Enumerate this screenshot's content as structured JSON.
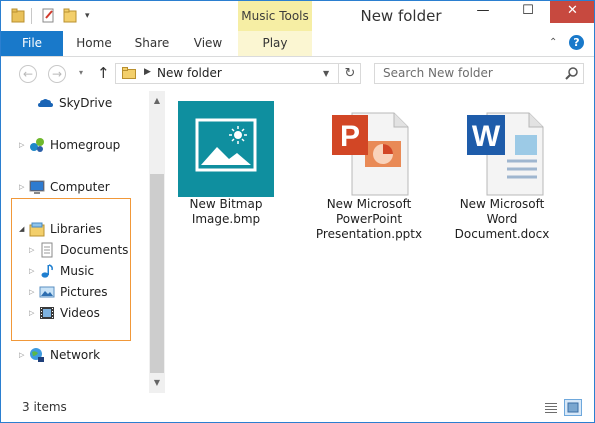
{
  "window": {
    "title": "New folder",
    "context_tab_group": "Music Tools",
    "close_glyph": "✕",
    "minimize_glyph": "—",
    "maximize_glyph": "☐"
  },
  "ribbon": {
    "tabs": [
      {
        "label": "File"
      },
      {
        "label": "Home"
      },
      {
        "label": "Share"
      },
      {
        "label": "View"
      },
      {
        "label": "Play"
      }
    ],
    "collapse_glyph": "⌃",
    "help_glyph": "?"
  },
  "navigation": {
    "back_glyph": "←",
    "forward_glyph": "→",
    "recent_glyph": "▾",
    "up_glyph": "↑",
    "address": {
      "path": "New folder",
      "separator_glyph": "▶",
      "dropdown_glyph": "▼",
      "refresh_glyph": "↻"
    },
    "search": {
      "placeholder": "Search New folder"
    }
  },
  "nav_pane": {
    "items": [
      {
        "label": "SkyDrive",
        "icon": "skydrive-icon"
      },
      {
        "label": "Homegroup",
        "icon": "homegroup-icon"
      },
      {
        "label": "Computer",
        "icon": "computer-icon"
      },
      {
        "label": "Libraries",
        "icon": "libraries-icon"
      },
      {
        "label": "Documents",
        "icon": "documents-icon"
      },
      {
        "label": "Music",
        "icon": "music-icon"
      },
      {
        "label": "Pictures",
        "icon": "pictures-icon"
      },
      {
        "label": "Videos",
        "icon": "videos-icon"
      },
      {
        "label": "Network",
        "icon": "network-icon"
      }
    ],
    "collapsed_glyph": "▷",
    "expanded_glyph": "◢",
    "highlight_color": "#f19839"
  },
  "scrollbar": {
    "up_glyph": "▲",
    "down_glyph": "▼"
  },
  "files": [
    {
      "name": "New Bitmap\nImage.bmp",
      "icon": "bitmap-image-icon"
    },
    {
      "name": "New Microsoft\nPowerPoint\nPresentation.pptx",
      "icon": "powerpoint-icon"
    },
    {
      "name": "New Microsoft\nWord\nDocument.docx",
      "icon": "word-icon"
    }
  ],
  "status": {
    "item_count": "3 items"
  },
  "colors": {
    "file_tab": "#1979ca",
    "context_tab": "#f6eea4",
    "close_button": "#c7493f",
    "bitmap_tile": "#0f8f9f"
  }
}
